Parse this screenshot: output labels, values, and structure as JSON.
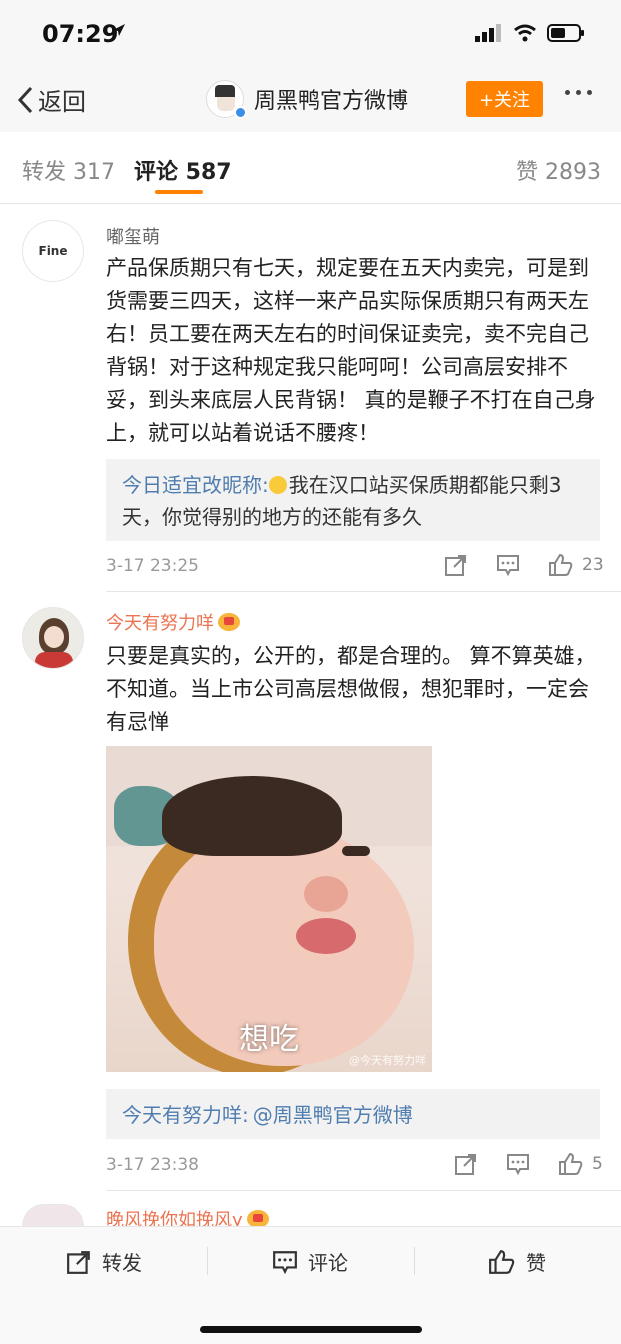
{
  "status": {
    "time": "07:29"
  },
  "nav": {
    "back_label": "返回",
    "title": "周黑鸭官方微博",
    "follow_label": "+关注"
  },
  "tabs": {
    "repost": "转发 317",
    "comment": "评论 587",
    "like": "赞 2893"
  },
  "comments": [
    {
      "username": "嘟玺萌",
      "avatar_text": "Fine",
      "text": "产品保质期只有七天，规定要在五天内卖完，可是到货需要三四天，这样一来产品实际保质期只有两天左右！员工要在两天左右的时间保证卖完，卖不完自己背锅！对于这种规定我只能呵呵！公司高层安排不妥，到头来底层人民背锅！ 真的是鞭子不打在自己身上，就可以站着说话不腰疼！",
      "reply_name": "今日适宜改昵称:",
      "reply_text": "我在汉口站买保质期都能只剩3天，你觉得别的地方的还能有多久",
      "time": "3-17 23:25",
      "likes": "23"
    },
    {
      "username": "今天有努力咩",
      "text": "只要是真实的，公开的，都是合理的。 算不算英雄，不知道。当上市公司高层想做假，想犯罪时，一定会有忌惮",
      "image_caption": "想吃",
      "image_watermark": "@今天有努力咩",
      "reply_name": "今天有努力咩:",
      "reply_text": "@周黑鸭官方微博",
      "time": "3-17 23:38",
      "likes": "5"
    },
    {
      "username": "晚风挽你如挽风y"
    }
  ],
  "bottom": {
    "repost": "转发",
    "comment": "评论",
    "like": "赞"
  },
  "colors": {
    "accent": "#ff8200",
    "link": "#507daf",
    "vip_name": "#eb7350"
  }
}
